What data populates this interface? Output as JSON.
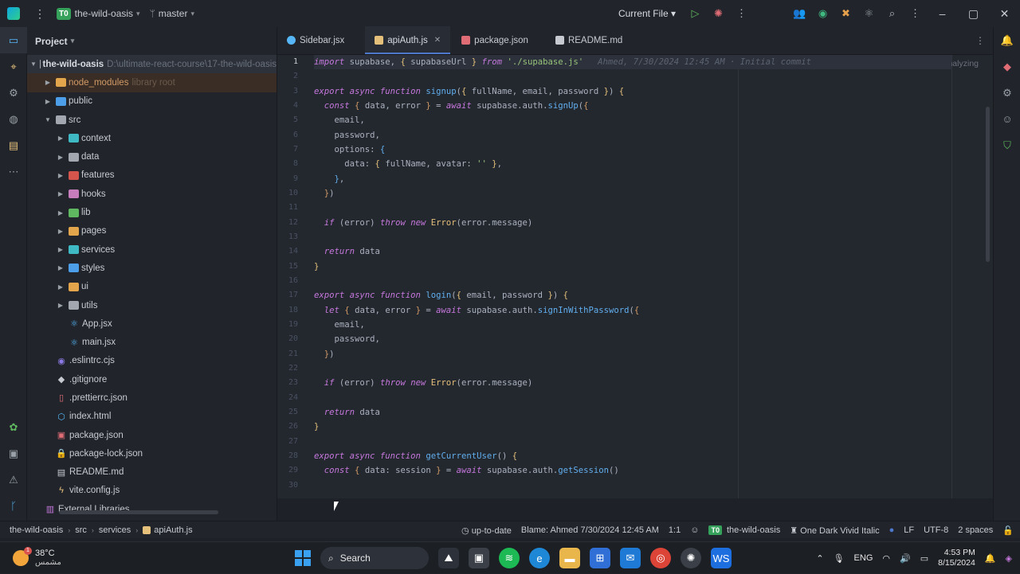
{
  "titlebar": {
    "project_badge": "T0",
    "project_name": "the-wild-oasis",
    "branch": "master",
    "run_config": "Current File"
  },
  "project_panel": {
    "title": "Project",
    "root": {
      "name": "the-wild-oasis",
      "path": "D:\\ultimate-react-course\\17-the-wild-oasis"
    },
    "node_modules": {
      "name": "node_modules",
      "hint": "library root"
    },
    "items": [
      {
        "name": "public"
      },
      {
        "name": "src"
      },
      {
        "name": "context"
      },
      {
        "name": "data"
      },
      {
        "name": "features"
      },
      {
        "name": "hooks"
      },
      {
        "name": "lib"
      },
      {
        "name": "pages"
      },
      {
        "name": "services"
      },
      {
        "name": "styles"
      },
      {
        "name": "ui"
      },
      {
        "name": "utils"
      },
      {
        "name": "App.jsx"
      },
      {
        "name": "main.jsx"
      },
      {
        "name": ".eslintrc.cjs"
      },
      {
        "name": ".gitignore"
      },
      {
        "name": ".prettierrc.json"
      },
      {
        "name": "index.html"
      },
      {
        "name": "package.json"
      },
      {
        "name": "package-lock.json"
      },
      {
        "name": "README.md"
      },
      {
        "name": "vite.config.js"
      },
      {
        "name": "External Libraries"
      }
    ]
  },
  "tabs": [
    {
      "label": "Sidebar.jsx"
    },
    {
      "label": "apiAuth.js"
    },
    {
      "label": "package.json"
    },
    {
      "label": "README.md"
    }
  ],
  "editor": {
    "analyzing": "Analyzing",
    "blame": "Ahmed, 7/30/2024 12:45 AM · Initial commit",
    "line_numbers": [
      "1",
      "2",
      "3",
      "4",
      "5",
      "6",
      "7",
      "8",
      "9",
      "10",
      "11",
      "12",
      "13",
      "14",
      "15",
      "16",
      "17",
      "18",
      "19",
      "20",
      "21",
      "22",
      "23",
      "24",
      "25",
      "26",
      "27",
      "28",
      "29",
      "30"
    ]
  },
  "statusbar": {
    "crumbs": [
      "the-wild-oasis",
      "src",
      "services",
      "apiAuth.js"
    ],
    "vcs_status": "up-to-date",
    "blame": "Blame: Ahmed 7/30/2024 12:45 AM",
    "position": "1:1",
    "project_badge": "T0",
    "project": "the-wild-oasis",
    "theme": "One Dark Vivid Italic",
    "line_sep": "LF",
    "encoding": "UTF-8",
    "indent": "2 spaces"
  },
  "taskbar": {
    "temperature": "38°C",
    "weather_text": "مشمس",
    "weather_badge": "1",
    "search": "Search",
    "language": "ENG",
    "time": "4:53 PM",
    "date": "8/15/2024"
  },
  "colors": {
    "accent": "#4d78cc",
    "keyword": "#c678dd",
    "string": "#98c379",
    "function": "#61afef",
    "project_badge": "#36a15b"
  }
}
